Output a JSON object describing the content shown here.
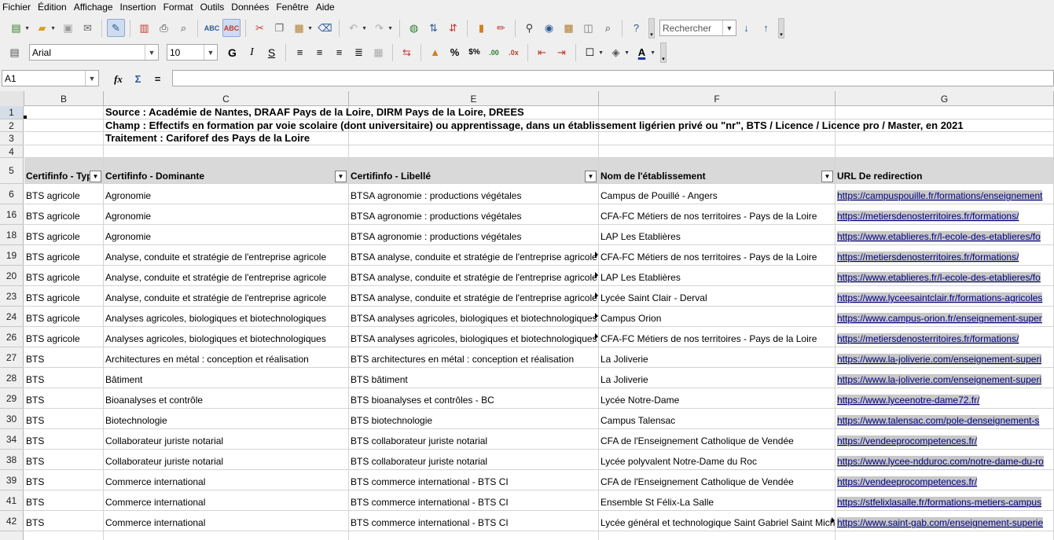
{
  "menu": [
    "Fichier",
    "Édition",
    "Affichage",
    "Insertion",
    "Format",
    "Outils",
    "Données",
    "Fenêtre",
    "Aide"
  ],
  "toolbar": {
    "search_placeholder": "Rechercher",
    "font_name": "Arial",
    "font_size": "10"
  },
  "formula": {
    "cell_ref": "A1",
    "content": ""
  },
  "columns": [
    "B",
    "C",
    "E",
    "F",
    "G"
  ],
  "rows_header": [
    {
      "num": "1",
      "source": "Source : Académie de Nantes, DRAAF Pays de la Loire, DIRM Pays de la Loire, DREES"
    },
    {
      "num": "2",
      "source": "Champ : Effectifs en formation par voie scolaire (dont universitaire) ou apprentissage, dans un établissement ligérien privé ou \"nr\", BTS / Licence / Licence pro / Master, en 2021"
    },
    {
      "num": "3",
      "source": "Traitement : Cariforef des Pays de la Loire"
    },
    {
      "num": "4",
      "source": ""
    }
  ],
  "table_header": {
    "num": "5",
    "type": "Certifinfo - Type",
    "dominante": "Certifinfo - Dominante",
    "libelle": "Certifinfo - Libellé",
    "etablissement": "Nom de l'établissement",
    "url": "URL De redirection"
  },
  "rows": [
    {
      "num": "6",
      "type": "BTS agricole",
      "dominante": "Agronomie",
      "libelle": "BTSA agronomie : productions végétales",
      "etab": "Campus de Pouillé - Angers",
      "url": "https://campuspouille.fr/formations/enseignement"
    },
    {
      "num": "16",
      "type": "BTS agricole",
      "dominante": "Agronomie",
      "libelle": "BTSA agronomie : productions végétales",
      "etab": "CFA-FC Métiers de nos territoires - Pays de la Loire",
      "url": "https://metiersdenosterritoires.fr/formations/"
    },
    {
      "num": "18",
      "type": "BTS agricole",
      "dominante": "Agronomie",
      "libelle": "BTSA agronomie : productions végétales",
      "etab": "LAP Les Etablières",
      "url": "https://www.etablieres.fr/l-ecole-des-etablieres/fo"
    },
    {
      "num": "19",
      "type": "BTS agricole",
      "dominante": "Analyse, conduite et stratégie de l'entreprise agricole",
      "libelle": "BTSA analyse, conduite et stratégie de l'entreprise agricole",
      "etab": "CFA-FC Métiers de nos territoires - Pays de la Loire",
      "url": "https://metiersdenosterritoires.fr/formations/"
    },
    {
      "num": "20",
      "type": "BTS agricole",
      "dominante": "Analyse, conduite et stratégie de l'entreprise agricole",
      "libelle": "BTSA analyse, conduite et stratégie de l'entreprise agricole",
      "etab": "LAP Les Etablières",
      "url": "https://www.etablieres.fr/l-ecole-des-etablieres/fo"
    },
    {
      "num": "23",
      "type": "BTS agricole",
      "dominante": "Analyse, conduite et stratégie de l'entreprise agricole",
      "libelle": "BTSA analyse, conduite et stratégie de l'entreprise agricole",
      "etab": "Lycée Saint Clair - Derval",
      "url": "https://www.lyceesaintclair.fr/formations-agricoles"
    },
    {
      "num": "24",
      "type": "BTS agricole",
      "dominante": "Analyses agricoles, biologiques et biotechnologiques",
      "libelle": "BTSA analyses agricoles, biologiques et biotechnologiques",
      "etab": "Campus Orion",
      "url": "https://www.campus-orion.fr/enseignement-super"
    },
    {
      "num": "26",
      "type": "BTS agricole",
      "dominante": "Analyses agricoles, biologiques et biotechnologiques",
      "libelle": "BTSA analyses agricoles, biologiques et biotechnologiques",
      "etab": "CFA-FC Métiers de nos territoires - Pays de la Loire",
      "url": "https://metiersdenosterritoires.fr/formations/"
    },
    {
      "num": "27",
      "type": "BTS",
      "dominante": "Architectures en métal : conception et réalisation",
      "libelle": "BTS architectures en métal : conception et réalisation",
      "etab": "La Joliverie",
      "url": "https://www.la-joliverie.com/enseignement-superi"
    },
    {
      "num": "28",
      "type": "BTS",
      "dominante": "Bâtiment",
      "libelle": "BTS bâtiment",
      "etab": "La Joliverie",
      "url": "https://www.la-joliverie.com/enseignement-superi"
    },
    {
      "num": "29",
      "type": "BTS",
      "dominante": "Bioanalyses et contrôle",
      "libelle": "BTS bioanalyses et contrôles - BC",
      "etab": "Lycée Notre-Dame",
      "url": "https://www.lyceenotre-dame72.fr/"
    },
    {
      "num": "30",
      "type": "BTS",
      "dominante": "Biotechnologie",
      "libelle": "BTS biotechnologie",
      "etab": "Campus Talensac",
      "url": "https://www.talensac.com/pole-denseignement-s"
    },
    {
      "num": "34",
      "type": "BTS",
      "dominante": "Collaborateur juriste notarial",
      "libelle": "BTS collaborateur juriste notarial",
      "etab": "CFA de l'Enseignement Catholique de Vendée",
      "url": "https://vendeeprocompetences.fr/"
    },
    {
      "num": "38",
      "type": "BTS",
      "dominante": "Collaborateur juriste notarial",
      "libelle": "BTS collaborateur juriste notarial",
      "etab": "Lycée polyvalent Notre-Dame du Roc",
      "url": "https://www.lycee-ndduroc.com/notre-dame-du-ro"
    },
    {
      "num": "39",
      "type": "BTS",
      "dominante": "Commerce international",
      "libelle": "BTS commerce international - BTS CI",
      "etab": "CFA de l'Enseignement Catholique de Vendée",
      "url": "https://vendeeprocompetences.fr/"
    },
    {
      "num": "41",
      "type": "BTS",
      "dominante": "Commerce international",
      "libelle": "BTS commerce international - BTS CI",
      "etab": "Ensemble St Félix-La Salle",
      "url": "https://stfelixlasalle.fr/formations-metiers-campus"
    },
    {
      "num": "42",
      "type": "BTS",
      "dominante": "Commerce international",
      "libelle": "BTS commerce international - BTS CI",
      "etab": "Lycée général et technologique Saint Gabriel Saint Michel",
      "url": "https://www.saint-gab.com/enseignement-superie"
    }
  ]
}
